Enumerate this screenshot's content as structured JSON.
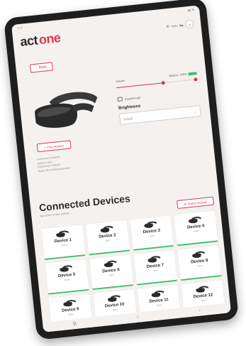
{
  "statusbar": {
    "time": "9:41",
    "icons": "▮▮ ◥"
  },
  "header": {
    "logo_part1": "act",
    "logo_part2": "one",
    "user_prefix": "Hello",
    "user_name": "Ira",
    "menu_chevron": "⌄"
  },
  "back_button": {
    "label": "Back",
    "icon": "chevron-left-icon"
  },
  "headset_panel": {
    "ping_label": "Ping Headset",
    "info_lines": [
      "Connection: Network",
      "Latency: 8ms",
      "Experience: CORSS",
      "Serial: 85-1F0694204200060"
    ]
  },
  "controls": {
    "volume_label": "Volume",
    "battery_label": "Battery: 100%",
    "volume_value": 0.58,
    "passthrough_label": "Passthrough",
    "brightness_label": "Brightness",
    "brightness_value": "Default",
    "select_chevron": "⌄"
  },
  "devices": {
    "title": "Connected Devices",
    "subtitle": "Tap device to view settings",
    "global_button_label": "Global Settings",
    "items": [
      {
        "name": "Device 1",
        "pct": "100%"
      },
      {
        "name": "Device 2",
        "pct": "100%"
      },
      {
        "name": "Device 3",
        "pct": "100%"
      },
      {
        "name": "Device 4",
        "pct": "100%"
      },
      {
        "name": "Device 5",
        "pct": "100%"
      },
      {
        "name": "Device 6",
        "pct": "100%"
      },
      {
        "name": "Device 7",
        "pct": "100%"
      },
      {
        "name": "Device 8",
        "pct": "100%"
      },
      {
        "name": "Device 9",
        "pct": "100%"
      },
      {
        "name": "Device 10",
        "pct": "100%"
      },
      {
        "name": "Device 11",
        "pct": "100%"
      },
      {
        "name": "Device 12",
        "pct": "100%"
      }
    ]
  },
  "navbar": {
    "menu": "|||",
    "home": "○",
    "back": "‹"
  },
  "colors": {
    "accent": "#e0364f",
    "battery": "#3fbf6a",
    "text": "#2b2b2b"
  }
}
